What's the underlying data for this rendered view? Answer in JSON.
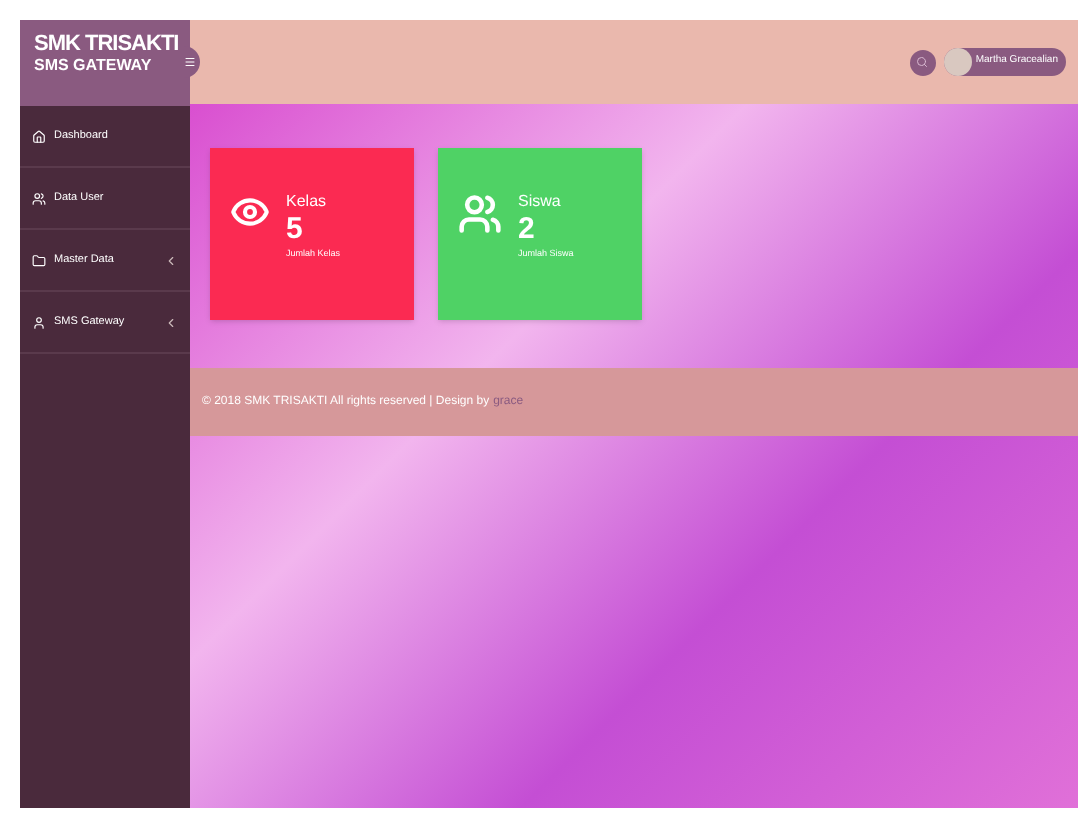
{
  "brand": {
    "title": "SMK TRISAKTI",
    "subtitle": "SMS GATEWAY"
  },
  "sidebar": {
    "items": [
      {
        "label": "Dashboard",
        "kind": "home",
        "has_submenu": false
      },
      {
        "label": "Data User",
        "kind": "users",
        "has_submenu": false
      },
      {
        "label": "Master Data",
        "kind": "folder",
        "has_submenu": true
      },
      {
        "label": "SMS Gateway",
        "kind": "user",
        "has_submenu": true
      }
    ]
  },
  "header": {
    "user_name": "Martha Gracealian"
  },
  "cards": [
    {
      "kind": "eye",
      "color": "#fb2a52",
      "title": "Kelas",
      "count": "5",
      "caption": "Jumlah Kelas"
    },
    {
      "kind": "group",
      "color": "#4fd265",
      "title": "Siswa",
      "count": "2",
      "caption": "Jumlah Siswa"
    }
  ],
  "footer": {
    "text": "© 2018 SMK TRISAKTI All rights reserved | Design by",
    "link": "grace"
  }
}
